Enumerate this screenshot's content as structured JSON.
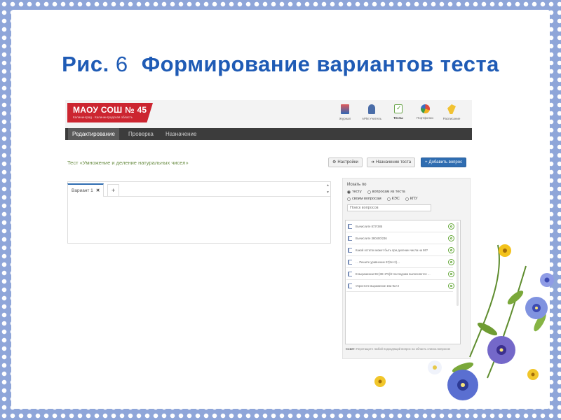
{
  "slide": {
    "title_prefix": "Рис.",
    "title_number": "6",
    "title_text": "Формирование вариантов теста"
  },
  "app": {
    "brand": {
      "name": "МАОУ СОШ № 45",
      "subtitle": "Калининград · Калининградская область"
    },
    "top_nav": [
      {
        "label": "Журнал",
        "icon": "journal-icon"
      },
      {
        "label": "АРМ Учитель",
        "icon": "teacher-icon"
      },
      {
        "label": "Тесты",
        "icon": "tests-icon"
      },
      {
        "label": "Портфолио",
        "icon": "portfolio-icon"
      },
      {
        "label": "Расписание",
        "icon": "schedule-icon"
      }
    ],
    "menu": [
      {
        "label": "Редактирование",
        "active": true
      },
      {
        "label": "Проверка",
        "active": false
      },
      {
        "label": "Назначение",
        "active": false
      }
    ],
    "test_title": "Тест «Умножение и деление натуральных чисел»",
    "buttons": {
      "settings": {
        "label": "Настройки",
        "icon": "gear-icon"
      },
      "assign": {
        "label": "Назначение теста",
        "icon": "arrow-right-icon"
      },
      "add_question": {
        "label": "Добавить вопрос",
        "icon": "plus-icon"
      }
    },
    "variant_tabs": {
      "active_tab": "Вариант 1",
      "close_glyph": "✕",
      "add_glyph": "+"
    },
    "search_panel": {
      "title": "Искать по",
      "options_row1": [
        {
          "label": "тесту",
          "selected": true
        },
        {
          "label": "вопросам из теста",
          "selected": false
        }
      ],
      "options_row2": [
        {
          "label": "своим вопросам",
          "selected": false
        },
        {
          "label": "КЭС",
          "selected": false
        },
        {
          "label": "КПУ",
          "selected": false
        }
      ],
      "search_placeholder": "Поиск вопросов",
      "questions": [
        "Вычислите 873*385",
        "Вычислите 380400/236",
        "Какой остаток может быть при делении числа на 86?",
        "… Решите уравнение 6*(8x+2)…",
        "В выражении 96:(38+2*5)/2 последним выполняется …",
        "Упростите выражение 16а-9а+2"
      ],
      "tip_label": "Совет:",
      "tip_text": "Перетащите любой подходящий вопрос на область списка вопросов"
    }
  }
}
